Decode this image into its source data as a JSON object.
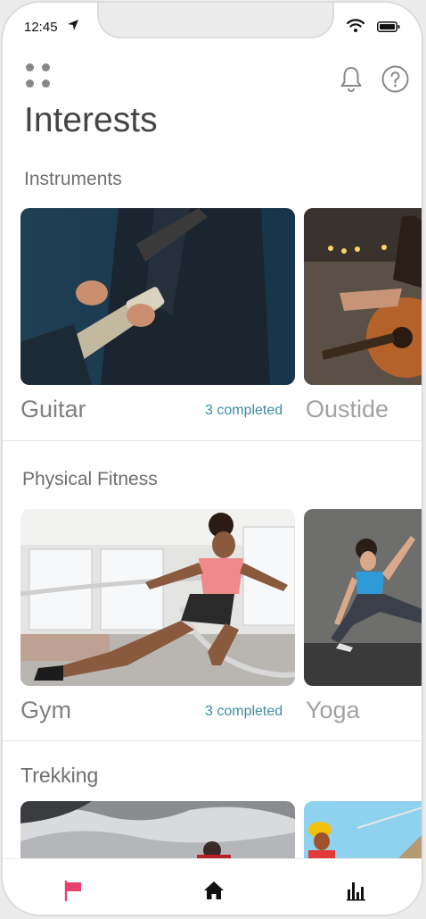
{
  "status_bar": {
    "time": "12:45"
  },
  "header": {
    "title": "Interests"
  },
  "sections": [
    {
      "title": "Instruments",
      "cards": [
        {
          "label": "Guitar",
          "completed": "3 completed"
        },
        {
          "label": "Oustide"
        }
      ]
    },
    {
      "title": "Physical Fitness",
      "cards": [
        {
          "label": "Gym",
          "completed": "3 completed"
        },
        {
          "label": "Yoga"
        }
      ]
    },
    {
      "title": "Trekking",
      "cards": [
        {},
        {}
      ]
    }
  ],
  "tab_bar": {
    "items": [
      {
        "icon": "flag-icon",
        "active": true
      },
      {
        "icon": "home-icon",
        "active": false
      },
      {
        "icon": "bar-chart-icon",
        "active": false
      }
    ]
  },
  "colors": {
    "accent_completed": "#3b8ba6",
    "tab_active": "#e8416a",
    "text_primary": "#444444"
  }
}
